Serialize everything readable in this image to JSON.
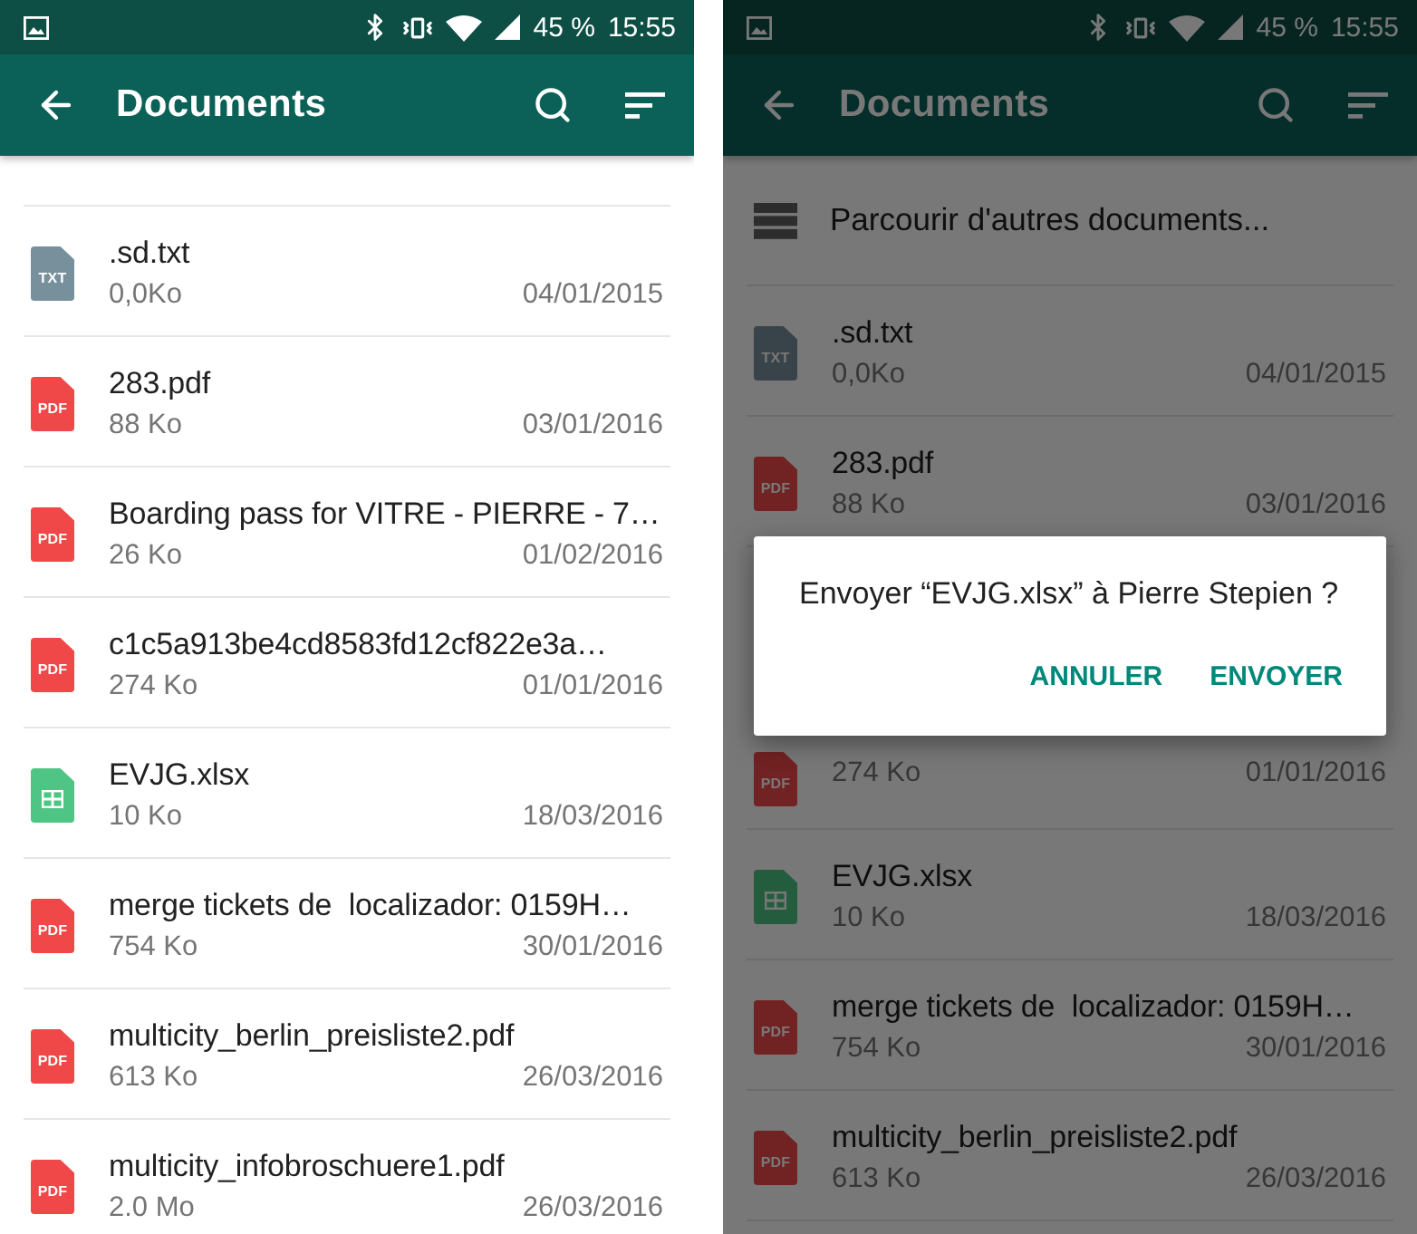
{
  "screens": [
    {
      "dimmed": false,
      "status_bar": {
        "battery": "45 %",
        "time": "15:55"
      },
      "app_bar": {
        "title": "Documents"
      },
      "files": [
        {
          "kind": "txt",
          "badge": "TXT",
          "name": ".sd.txt",
          "size": "0,0Ko",
          "date": "04/01/2015"
        },
        {
          "kind": "pdf",
          "badge": "PDF",
          "name": "283.pdf",
          "size": "88 Ko",
          "date": "03/01/2016"
        },
        {
          "kind": "pdf",
          "badge": "PDF",
          "name": "Boarding pass for VITRE - PIERRE - 7…",
          "size": "26 Ko",
          "date": "01/02/2016"
        },
        {
          "kind": "pdf",
          "badge": "PDF",
          "name": "c1c5a913be4cd8583fd12cf822e3a…",
          "size": "274 Ko",
          "date": "01/01/2016"
        },
        {
          "kind": "xlsx",
          "name": "EVJG.xlsx",
          "size": "10 Ko",
          "date": "18/03/2016"
        },
        {
          "kind": "pdf",
          "badge": "PDF",
          "name": "merge tickets de  localizador: 0159H…",
          "size": "754 Ko",
          "date": "30/01/2016"
        },
        {
          "kind": "pdf",
          "badge": "PDF",
          "name": "multicity_berlin_preisliste2.pdf",
          "size": "613 Ko",
          "date": "26/03/2016"
        },
        {
          "kind": "pdf",
          "badge": "PDF",
          "name": "multicity_infobroschuere1.pdf",
          "size": "2.0 Mo",
          "date": "26/03/2016"
        }
      ]
    },
    {
      "dimmed": true,
      "status_bar": {
        "battery": "45 %",
        "time": "15:55"
      },
      "app_bar": {
        "title": "Documents"
      },
      "browse_item": {
        "label": "Parcourir d'autres documents..."
      },
      "files": [
        {
          "kind": "txt",
          "badge": "TXT",
          "name": ".sd.txt",
          "size": "0,0Ko",
          "date": "04/01/2015"
        },
        {
          "kind": "pdf",
          "badge": "PDF",
          "name": "283.pdf",
          "size": "88 Ko",
          "date": "03/01/2016"
        },
        {
          "kind": "pdf",
          "badge": "PDF",
          "size": "274 Ko",
          "date": "01/01/2016"
        },
        {
          "kind": "xlsx",
          "name": "EVJG.xlsx",
          "size": "10 Ko",
          "date": "18/03/2016"
        },
        {
          "kind": "pdf",
          "badge": "PDF",
          "name": "merge tickets de  localizador: 0159H…",
          "size": "754 Ko",
          "date": "30/01/2016"
        },
        {
          "kind": "pdf",
          "badge": "PDF",
          "name": "multicity_berlin_preisliste2.pdf",
          "size": "613 Ko",
          "date": "26/03/2016"
        }
      ],
      "dialog": {
        "message": "Envoyer “EVJG.xlsx” à Pierre Stepien ?",
        "buttons": [
          "ANNULER",
          "ENVOYER"
        ]
      }
    }
  ]
}
